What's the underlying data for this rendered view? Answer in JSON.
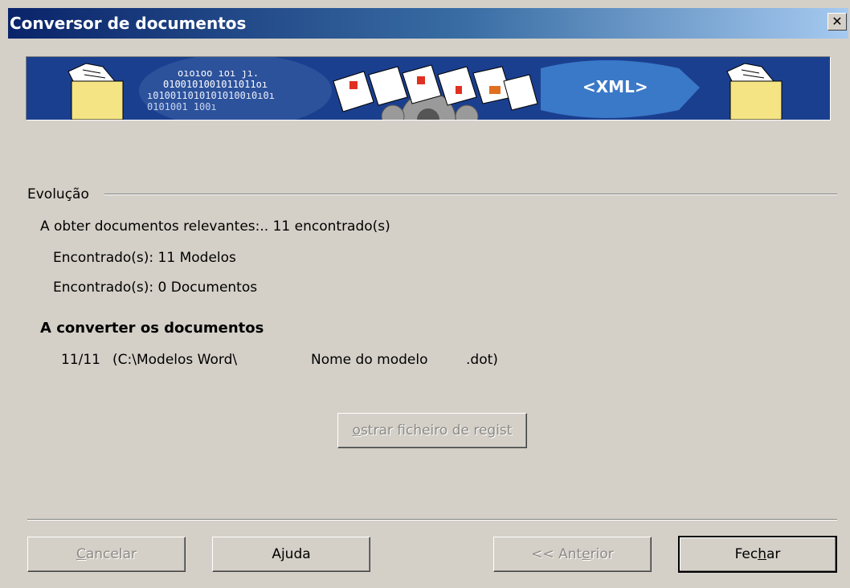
{
  "window": {
    "title": "Conversor de documentos",
    "close_glyph": "✕"
  },
  "banner": {
    "xml_label": "<XML>",
    "binary_lines": [
      "oıoıoo ıoı  ȷı.",
      "0100101001011011oı",
      "ı0100110101010100ı0ı0ı",
      "0101001      100ı"
    ],
    "colors": {
      "background": "#1b3f8f",
      "folder": "#f5e484",
      "arrow": "#3a78c8"
    }
  },
  "progress": {
    "group_label": "Evolução",
    "lines": [
      "A obter documentos relevantes:..   11  encontrado(s)",
      "Encontrado(s): 11 Modelos",
      "Encontrado(s): 0 Documentos"
    ],
    "converting_heading": "A converter os documentos",
    "current_item": {
      "counter": "11/11",
      "path": "(C:\\Modelos Word\\",
      "name": "Nome do modelo",
      "ext": ".dot)"
    },
    "log_button_label": "ostrar ficheiro de regist",
    "log_button_underline": "o",
    "log_button_rest": "strar ficheiro de regist"
  },
  "buttons": {
    "cancel": {
      "u": "C",
      "rest": "ancelar"
    },
    "help": {
      "label": "Ajuda"
    },
    "back": {
      "pre": "<< Ant",
      "u": "e",
      "post": "rior"
    },
    "close": {
      "pre": "Fec",
      "u": "h",
      "post": "ar"
    }
  }
}
